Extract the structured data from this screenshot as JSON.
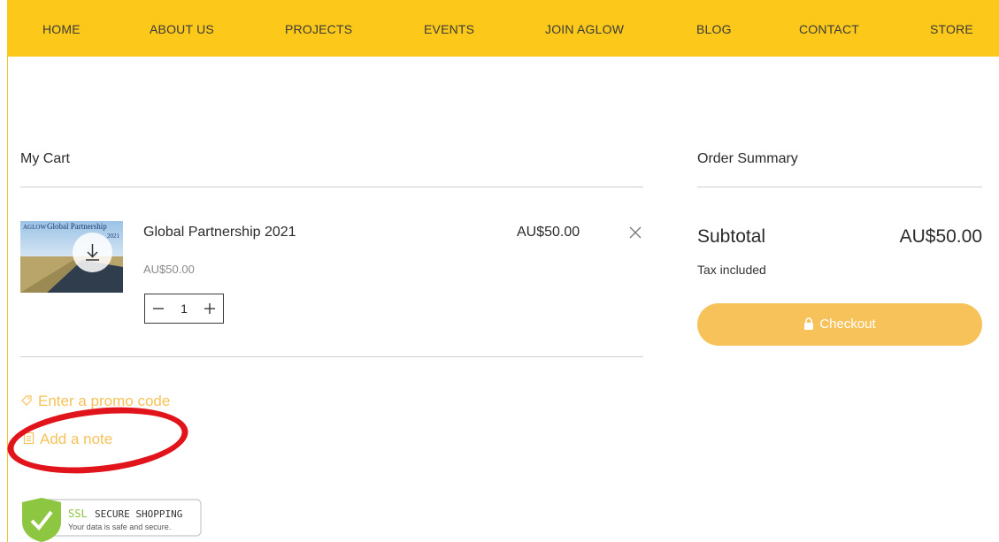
{
  "nav": {
    "items": [
      "HOME",
      "ABOUT US",
      "PROJECTS",
      "EVENTS",
      "JOIN AGLOW",
      "BLOG",
      "CONTACT",
      "STORE"
    ]
  },
  "cart": {
    "title": "My Cart",
    "item": {
      "name": "Global Partnership 2021",
      "unit_price": "AU$50.00",
      "price": "AU$50.00",
      "quantity": "1",
      "image_text": "Global Partnership",
      "image_year": "2021",
      "image_logo": "AGLOW"
    },
    "promo_link": "Enter a promo code",
    "note_link": "Add a note"
  },
  "summary": {
    "title": "Order Summary",
    "subtotal_label": "Subtotal",
    "subtotal_value": "AU$50.00",
    "tax_note": "Tax included",
    "checkout_label": "Checkout"
  },
  "badge": {
    "line1_a": "SSL",
    "line1_b": "SECURE SHOPPING",
    "line2": "Your data is safe and secure."
  },
  "colors": {
    "nav_bg": "#fcc81a",
    "accent": "#f7c259",
    "annotation": "#e0141a"
  },
  "icons": [
    "close-icon",
    "minus-icon",
    "plus-icon",
    "download-icon",
    "tag-icon",
    "note-icon",
    "lock-icon",
    "checkmark-shield-icon"
  ]
}
